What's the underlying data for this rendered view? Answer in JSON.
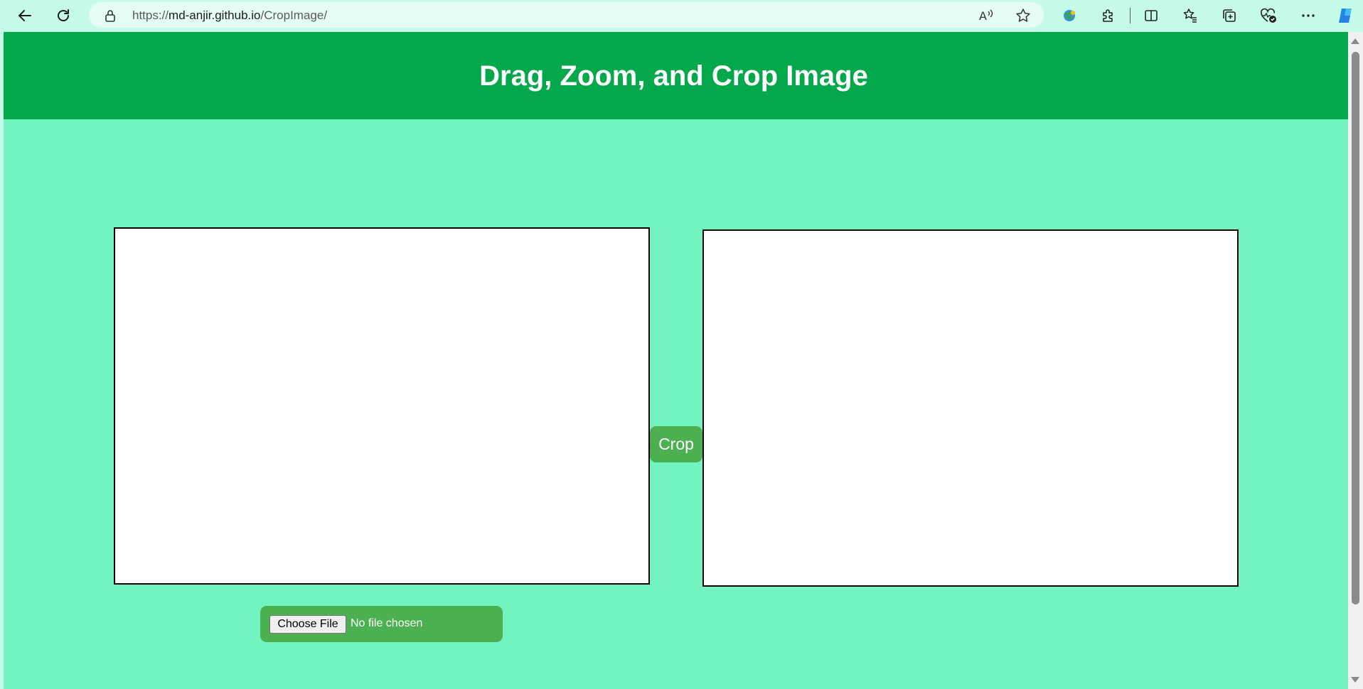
{
  "browser": {
    "url_prefix": "https://",
    "url_host": "md-anjir.github.io",
    "url_path": "/CropImage/",
    "icons": [
      "back-icon",
      "refresh-icon",
      "lock-icon",
      "read-aloud-icon",
      "favorite-star-icon",
      "extension-globe-icon",
      "extensions-puzzle-icon",
      "split-screen-icon",
      "favorites-icon",
      "collections-icon",
      "browser-essentials-icon",
      "more-icon",
      "copilot-icon"
    ]
  },
  "page": {
    "title": "Drag, Zoom, and Crop Image",
    "crop_button": "Crop",
    "file_input": {
      "button_label": "Choose File",
      "status": "No file chosen"
    }
  },
  "colors": {
    "header_bg": "#02a84a",
    "page_bg": "#72f3c0",
    "button_green": "#4caf50",
    "browser_bg": "#c6fbe9"
  }
}
